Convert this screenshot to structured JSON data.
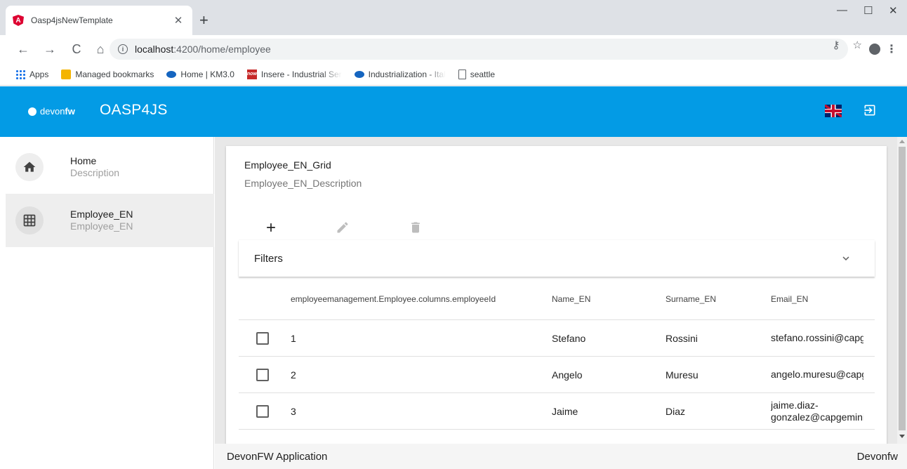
{
  "browser": {
    "tab_title": "Oasp4jsNewTemplate",
    "tab_close": "✕",
    "new_tab": "+",
    "window_controls": {
      "minimize": "—",
      "maximize": "☐",
      "close": "✕"
    },
    "nav": {
      "back": "←",
      "forward": "→",
      "reload": "C",
      "home": "⌂"
    },
    "url_host": "localhost",
    "url_path": ":4200/home/employee",
    "omnibox_icons": {
      "key": "⚷",
      "star": "☆"
    },
    "menu": "⋮",
    "bookmarks": [
      {
        "label": "Apps",
        "icon": "apps-grid-icon"
      },
      {
        "label": "Managed bookmarks",
        "icon": "folder-icon"
      },
      {
        "label": "Home | KM3.0",
        "icon": "cloud-icon"
      },
      {
        "label": "Insere - Industrial Ser",
        "icon": "now-icon"
      },
      {
        "label": "Industrialization - Ital",
        "icon": "cloud-icon"
      },
      {
        "label": "seattle",
        "icon": "page-icon"
      }
    ]
  },
  "header": {
    "logo_prefix": "devon",
    "logo_suffix": "fw",
    "app_title": "OASP4JS",
    "language_flag": "uk-flag-icon",
    "logout_icon": "logout-icon"
  },
  "sidebar": {
    "items": [
      {
        "title": "Home",
        "subtitle": "Description",
        "icon": "home-icon",
        "active": false
      },
      {
        "title": "Employee_EN",
        "subtitle": "Employee_EN",
        "icon": "grid-icon",
        "active": true
      }
    ]
  },
  "main": {
    "title": "Employee_EN_Grid",
    "description": "Employee_EN_Description",
    "actions": [
      {
        "name": "add",
        "icon": "plus-icon",
        "enabled": true
      },
      {
        "name": "edit",
        "icon": "pencil-icon",
        "enabled": false
      },
      {
        "name": "delete",
        "icon": "trash-icon",
        "enabled": false
      }
    ],
    "filters_label": "Filters",
    "columns": [
      "employeemanagement.Employee.columns.employeeId",
      "Name_EN",
      "Surname_EN",
      "Email_EN"
    ],
    "rows": [
      {
        "id": "1",
        "name": "Stefano",
        "surname": "Rossini",
        "email": "stefano.rossini@capgemini.com"
      },
      {
        "id": "2",
        "name": "Angelo",
        "surname": "Muresu",
        "email": "angelo.muresu@capgemini.com"
      },
      {
        "id": "3",
        "name": "Jaime",
        "surname": "Diaz",
        "email_line1": "jaime.diaz-",
        "email_line2": "gonzalez@capgemini.com"
      }
    ]
  },
  "footer": {
    "left": "DevonFW Application",
    "right": "Devonfw"
  },
  "colors": {
    "primary": "#039be5",
    "sidebar_active": "#eeeeee",
    "content_bg": "#e8e8e8"
  }
}
